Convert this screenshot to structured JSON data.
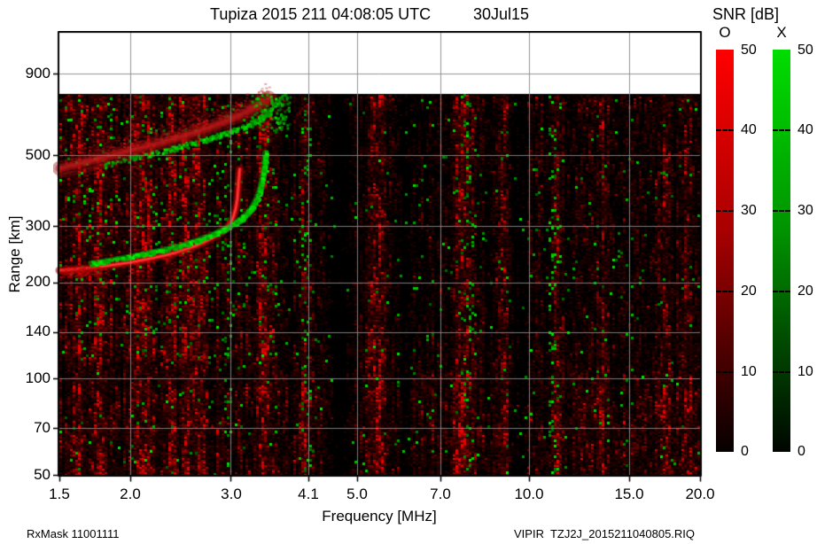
{
  "header": {
    "title": "Tupiza 2015 211 04:08:05 UTC",
    "date": "30Jul15"
  },
  "footer": {
    "left": "RxMask 11001111",
    "right": "VIPIR  TZJ2J_2015211040805.RIQ"
  },
  "colorbar": {
    "title": "SNR [dB]",
    "o_label": "O",
    "x_label": "X",
    "tick_labels": [
      "50",
      "40",
      "30",
      "20",
      "10",
      "0"
    ],
    "o_color_max": "#ff0000",
    "x_color_max": "#00dd00"
  },
  "chart_data": {
    "type": "heatmap",
    "title": "Tupiza 2015 211 04:08:05 UTC 30Jul15",
    "subtitle": "VIPIR ionogram, O-mode (red) and X-mode (green) SNR in dB",
    "xlabel": "Frequency [MHz]",
    "ylabel": "Range [km]",
    "x_scale": "log",
    "y_scale": "log",
    "xlim": [
      1.5,
      20.0
    ],
    "ylim": [
      50,
      1207
    ],
    "x_ticks": [
      1.5,
      2.0,
      3.0,
      4.1,
      5.0,
      7.0,
      10.0,
      15.0,
      20.0
    ],
    "x_tick_labels": [
      "1.5",
      "2.0",
      "3.0",
      "4.1",
      "5.0",
      "7.0",
      "10.0",
      "15.0",
      "20.0"
    ],
    "y_ticks": [
      900,
      500,
      300,
      200,
      140,
      100,
      70,
      50
    ],
    "y_tick_labels": [
      "900",
      "500",
      "300",
      "200",
      "140",
      "100",
      "70",
      "50"
    ],
    "snr_range_db": [
      0,
      50
    ],
    "data_top_km": 777,
    "background_color": "#000000",
    "grid_color": "#888888",
    "legend_position": "right",
    "grid": true,
    "traces": {
      "o_main": {
        "mode": "O",
        "critical_freq_mhz": 3.1,
        "points": [
          [
            1.5,
            218
          ],
          [
            1.6,
            220
          ],
          [
            1.7,
            222
          ],
          [
            1.8,
            225
          ],
          [
            1.9,
            228
          ],
          [
            2.0,
            231
          ],
          [
            2.1,
            235
          ],
          [
            2.2,
            239
          ],
          [
            2.3,
            243
          ],
          [
            2.4,
            248
          ],
          [
            2.5,
            254
          ],
          [
            2.6,
            260
          ],
          [
            2.7,
            268
          ],
          [
            2.8,
            277
          ],
          [
            2.9,
            288
          ],
          [
            2.95,
            296
          ],
          [
            3.0,
            306
          ],
          [
            3.03,
            320
          ],
          [
            3.06,
            340
          ],
          [
            3.08,
            365
          ],
          [
            3.09,
            395
          ],
          [
            3.1,
            425
          ],
          [
            3.11,
            452
          ]
        ]
      },
      "x_main": {
        "mode": "X",
        "critical_freq_mhz": 3.44,
        "points": [
          [
            1.7,
            230
          ],
          [
            1.85,
            236
          ],
          [
            2.0,
            242
          ],
          [
            2.15,
            248
          ],
          [
            2.3,
            255
          ],
          [
            2.45,
            262
          ],
          [
            2.6,
            271
          ],
          [
            2.75,
            281
          ],
          [
            2.9,
            293
          ],
          [
            3.05,
            308
          ],
          [
            3.15,
            322
          ],
          [
            3.25,
            342
          ],
          [
            3.32,
            366
          ],
          [
            3.37,
            395
          ],
          [
            3.4,
            428
          ],
          [
            3.42,
            462
          ],
          [
            3.43,
            492
          ],
          [
            3.44,
            512
          ]
        ]
      },
      "o_second": {
        "mode": "O",
        "diffuse": true,
        "points": [
          [
            1.5,
            455
          ],
          [
            1.6,
            467
          ],
          [
            1.7,
            480
          ],
          [
            1.8,
            492
          ],
          [
            1.9,
            505
          ],
          [
            2.0,
            517
          ],
          [
            2.1,
            528
          ],
          [
            2.2,
            540
          ],
          [
            2.3,
            552
          ],
          [
            2.4,
            564
          ],
          [
            2.5,
            576
          ],
          [
            2.6,
            590
          ],
          [
            2.7,
            603
          ],
          [
            2.8,
            617
          ],
          [
            2.9,
            632
          ],
          [
            3.0,
            648
          ],
          [
            3.1,
            665
          ],
          [
            3.2,
            684
          ],
          [
            3.3,
            706
          ],
          [
            3.4,
            730
          ],
          [
            3.5,
            756
          ]
        ]
      },
      "x_second": {
        "mode": "X",
        "dotted": true,
        "points": [
          [
            1.8,
            468
          ],
          [
            1.95,
            484
          ],
          [
            2.1,
            500
          ],
          [
            2.25,
            515
          ],
          [
            2.4,
            530
          ],
          [
            2.55,
            545
          ],
          [
            2.7,
            561
          ],
          [
            2.85,
            578
          ],
          [
            3.0,
            596
          ],
          [
            3.15,
            616
          ],
          [
            3.3,
            640
          ],
          [
            3.4,
            664
          ],
          [
            3.5,
            692
          ],
          [
            3.58,
            722
          ],
          [
            3.62,
            752
          ]
        ]
      },
      "o_second_faint": {
        "mode": "O",
        "faint": true,
        "points": [
          [
            1.5,
            430
          ],
          [
            1.62,
            442
          ],
          [
            1.75,
            456
          ],
          [
            1.88,
            470
          ]
        ]
      },
      "green_patch": {
        "f_range": [
          3.25,
          3.8
        ],
        "km_range": [
          600,
          780
        ],
        "count": 110
      }
    },
    "noise": {
      "hot_red_freqs": [
        1.62,
        1.75,
        2.05,
        2.14,
        2.35,
        2.5,
        2.62,
        3.38,
        4.02,
        5.3,
        5.45,
        7.5,
        7.62,
        7.8,
        9.0,
        11.1,
        13.4,
        17.3,
        18.8
      ],
      "quiet_freqs": [
        4.55,
        4.7,
        6.0,
        9.6
      ],
      "green_freqs": [
        2.95,
        4.05,
        7.8,
        11.0
      ],
      "green_p_base": 0.01,
      "spread": {
        "f_range": [
          1.5,
          3.6
        ],
        "km_range": [
          115,
          800
        ],
        "red_boost": 1.75,
        "green_p_extra": 0.018
      },
      "bottom_boost_km": 95
    }
  }
}
